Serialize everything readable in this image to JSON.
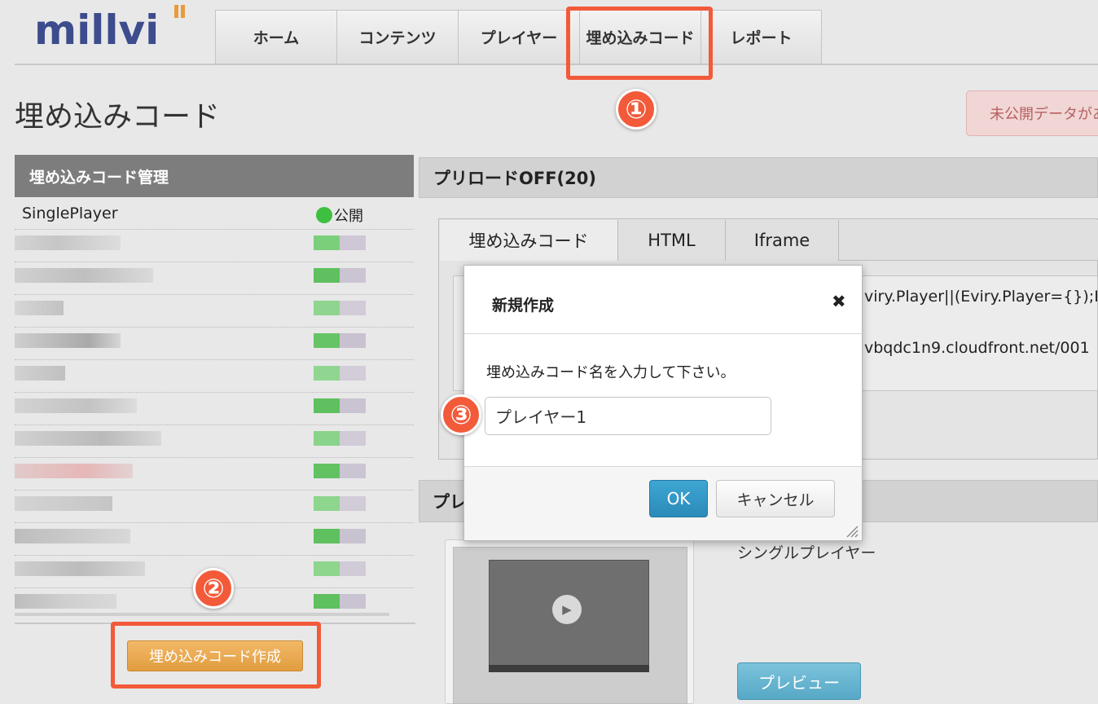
{
  "app": {
    "logo_text": "millvi"
  },
  "nav": {
    "tabs": [
      {
        "label": "ホーム"
      },
      {
        "label": "コンテンツ"
      },
      {
        "label": "プレイヤー"
      },
      {
        "label": "埋め込みコード"
      },
      {
        "label": "レポート"
      }
    ]
  },
  "page": {
    "title": "埋め込みコード",
    "unpublished_label": "未公開データがあります"
  },
  "callouts": [
    "①",
    "②",
    "③"
  ],
  "left_panel": {
    "header": "埋め込みコード管理",
    "first_row": {
      "name": "SinglePlayer",
      "status": "公開"
    },
    "create_button": "埋め込みコード作成"
  },
  "right_panel": {
    "header": "プリロードOFF(20)",
    "tabs": [
      {
        "label": "埋め込みコード"
      },
      {
        "label": "HTML"
      },
      {
        "label": "Iframe"
      }
    ],
    "code_lines": [
      "viry.Player||(Eviry.Player={});Ev",
      "vbqdc1n9.cloudfront.net/001"
    ]
  },
  "player_section": {
    "header_visible": "プレ",
    "player_label": "シングルプレイヤー",
    "preview_button": "プレビュー",
    "play_icon": "play-icon"
  },
  "modal": {
    "title": "新規作成",
    "close_glyph": "✖",
    "prompt": "埋め込みコード名を入力して下さい。",
    "input_value": "プレイヤー1",
    "ok_label": "OK",
    "cancel_label": "キャンセル"
  },
  "colors": {
    "callout": "#f25a3a",
    "create_button": "#e8a64d",
    "ok_button": "#3399cc",
    "status_green": "#3fbf3f"
  }
}
